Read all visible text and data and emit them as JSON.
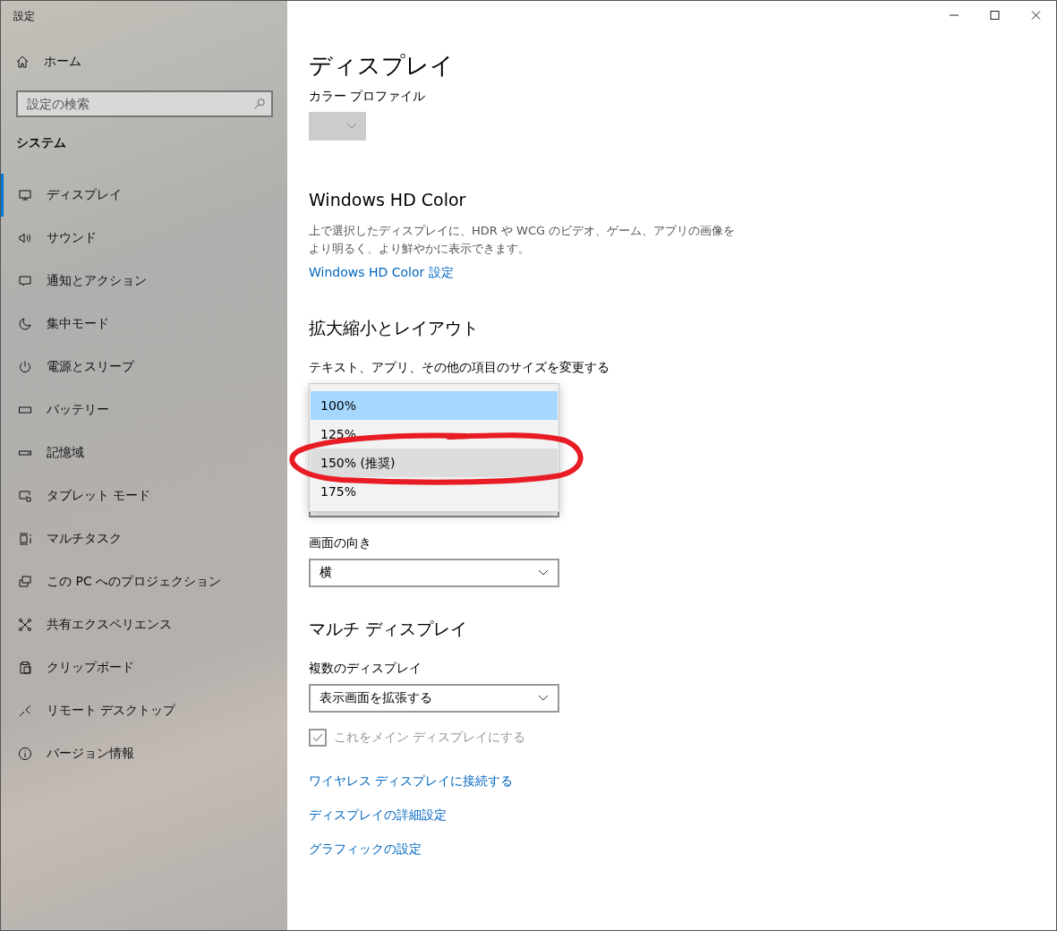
{
  "window": {
    "title": "設定"
  },
  "sidebar": {
    "home": "ホーム",
    "search": {
      "placeholder": "設定の検索"
    },
    "section": "システム",
    "items": [
      {
        "label": "ディスプレイ",
        "selected": true
      },
      {
        "label": "サウンド",
        "selected": false
      },
      {
        "label": "通知とアクション",
        "selected": false
      },
      {
        "label": "集中モード",
        "selected": false
      },
      {
        "label": "電源とスリープ",
        "selected": false
      },
      {
        "label": "バッテリー",
        "selected": false
      },
      {
        "label": "記憶域",
        "selected": false
      },
      {
        "label": "タブレット モード",
        "selected": false
      },
      {
        "label": "マルチタスク",
        "selected": false
      },
      {
        "label": "この PC へのプロジェクション",
        "selected": false
      },
      {
        "label": "共有エクスペリエンス",
        "selected": false
      },
      {
        "label": "クリップボード",
        "selected": false
      },
      {
        "label": "リモート デスクトップ",
        "selected": false
      },
      {
        "label": "バージョン情報",
        "selected": false
      }
    ]
  },
  "page": {
    "title": "ディスプレイ",
    "color_profile": {
      "label": "カラー プロファイル",
      "disabled": true
    },
    "hd_color": {
      "heading": "Windows HD Color",
      "description": [
        "上で選択したディスプレイに、HDR や WCG のビデオ、ゲーム、アプリの画像を",
        "より明るく、より鮮やかに表示できます。"
      ],
      "link": "Windows HD Color 設定"
    },
    "scale": {
      "heading": "拡大縮小とレイアウト",
      "label": "テキスト、アプリ、その他の項目のサイズを変更する",
      "options": [
        {
          "label": "100%",
          "selected": true,
          "hovered": false
        },
        {
          "label": "125%",
          "selected": false,
          "hovered": false
        },
        {
          "label": "150% (推奨)",
          "selected": false,
          "hovered": true
        },
        {
          "label": "175%",
          "selected": false,
          "hovered": false
        }
      ]
    },
    "orientation": {
      "label": "画面の向き",
      "value": "横"
    },
    "multi": {
      "heading": "マルチ ディスプレイ",
      "label": "複数のディスプレイ",
      "value": "表示画面を拡張する",
      "main_display": {
        "label": "これをメイン ディスプレイにする",
        "checked": true,
        "disabled": true
      }
    },
    "links": [
      "ワイヤレス ディスプレイに接続する",
      "ディスプレイの詳細設定",
      "グラフィックの設定"
    ]
  }
}
